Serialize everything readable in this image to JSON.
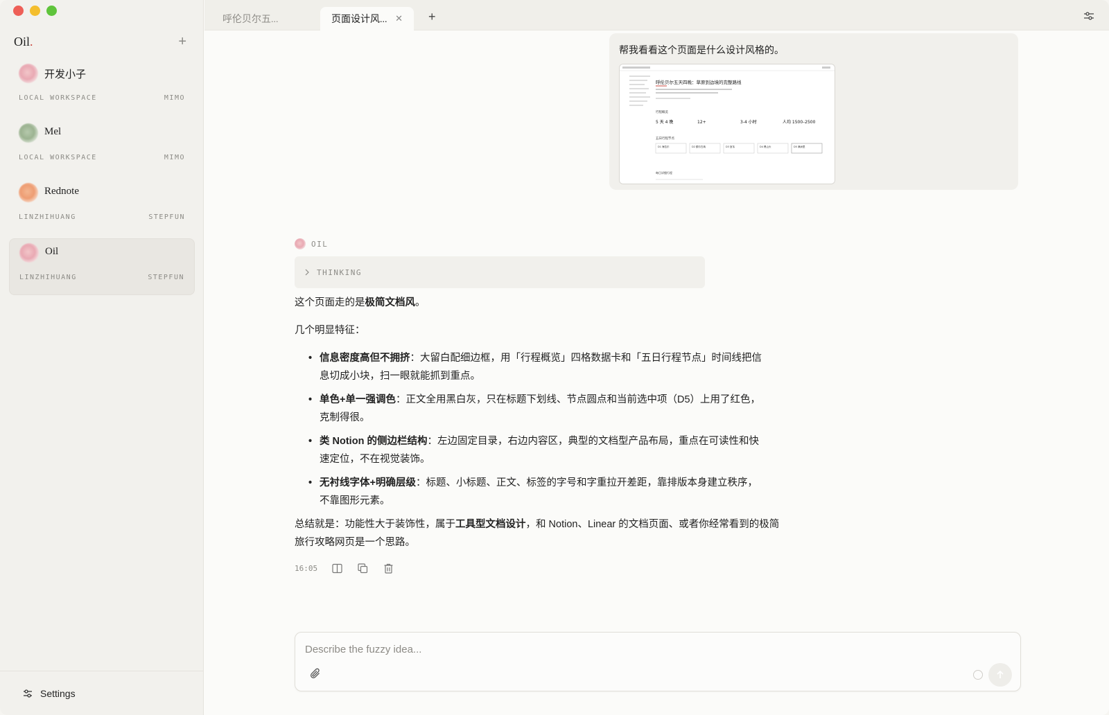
{
  "sidebar": {
    "brand": "Oil",
    "brand_dot": ".",
    "add_label": "+",
    "workspaces": [
      {
        "name": "开发小子",
        "left": "LOCAL WORKSPACE",
        "right": "MIMO"
      },
      {
        "name": "Mel",
        "left": "LOCAL WORKSPACE",
        "right": "MIMO"
      },
      {
        "name": "Rednote",
        "left": "LINZHIHUANG",
        "right": "STEPFUN"
      },
      {
        "name": "Oil",
        "left": "LINZHIHUANG",
        "right": "STEPFUN"
      }
    ],
    "settings_label": "Settings"
  },
  "tabs": [
    {
      "label": "呼伦贝尔五..."
    },
    {
      "label": "页面设计风...",
      "close": "✕"
    }
  ],
  "new_tab_label": "+",
  "user_message": {
    "text": "帮我看看这个页面是什么设计风格的。",
    "attachment": {
      "title": "呼伦贝尔五天四晚：草原到边境的完整路线",
      "section": "行程概览",
      "stats": [
        "5 天 4 晚",
        "12+",
        "3-4 小时",
        "人均 1500–2500"
      ],
      "timeline_title": "五日行程节点",
      "nodes": [
        "D1 海拉尔",
        "D2 额尔古纳",
        "D3 室韦",
        "D4 黑山头",
        "D5 满洲里"
      ],
      "footer": "每日详细行程"
    }
  },
  "assistant": {
    "name": "OIL",
    "thinking_label": "THINKING",
    "intro_prefix": "这个页面走的是",
    "intro_bold": "极简文档风",
    "intro_suffix": "。",
    "features_heading": "几个明显特征：",
    "features": [
      {
        "bold": "信息密度高但不拥挤",
        "text": "：大留白配细边框，用「行程概览」四格数据卡和「五日行程节点」时间线把信息切成小块，扫一眼就能抓到重点。"
      },
      {
        "bold": "单色+单一强调色",
        "text": "：正文全用黑白灰，只在标题下划线、节点圆点和当前选中项（D5）上用了红色，克制得很。"
      },
      {
        "bold": "类 Notion 的侧边栏结构",
        "text": "：左边固定目录，右边内容区，典型的文档型产品布局，重点在可读性和快速定位，不在视觉装饰。"
      },
      {
        "bold": "无衬线字体+明确层级",
        "text": "：标题、小标题、正文、标签的字号和字重拉开差距，靠排版本身建立秩序，不靠图形元素。"
      }
    ],
    "summary_prefix": "总结就是：功能性大于装饰性，属于",
    "summary_bold": "工具型文档设计",
    "summary_suffix": "，和 Notion、Linear 的文档页面、或者你经常看到的极简旅行攻略网页是一个思路。",
    "time": "16:05"
  },
  "composer": {
    "placeholder": "Describe the fuzzy idea..."
  },
  "colors": {
    "accent": "#c8453c",
    "background": "#fbfbf9",
    "sidebar": "#f2f1ed"
  }
}
